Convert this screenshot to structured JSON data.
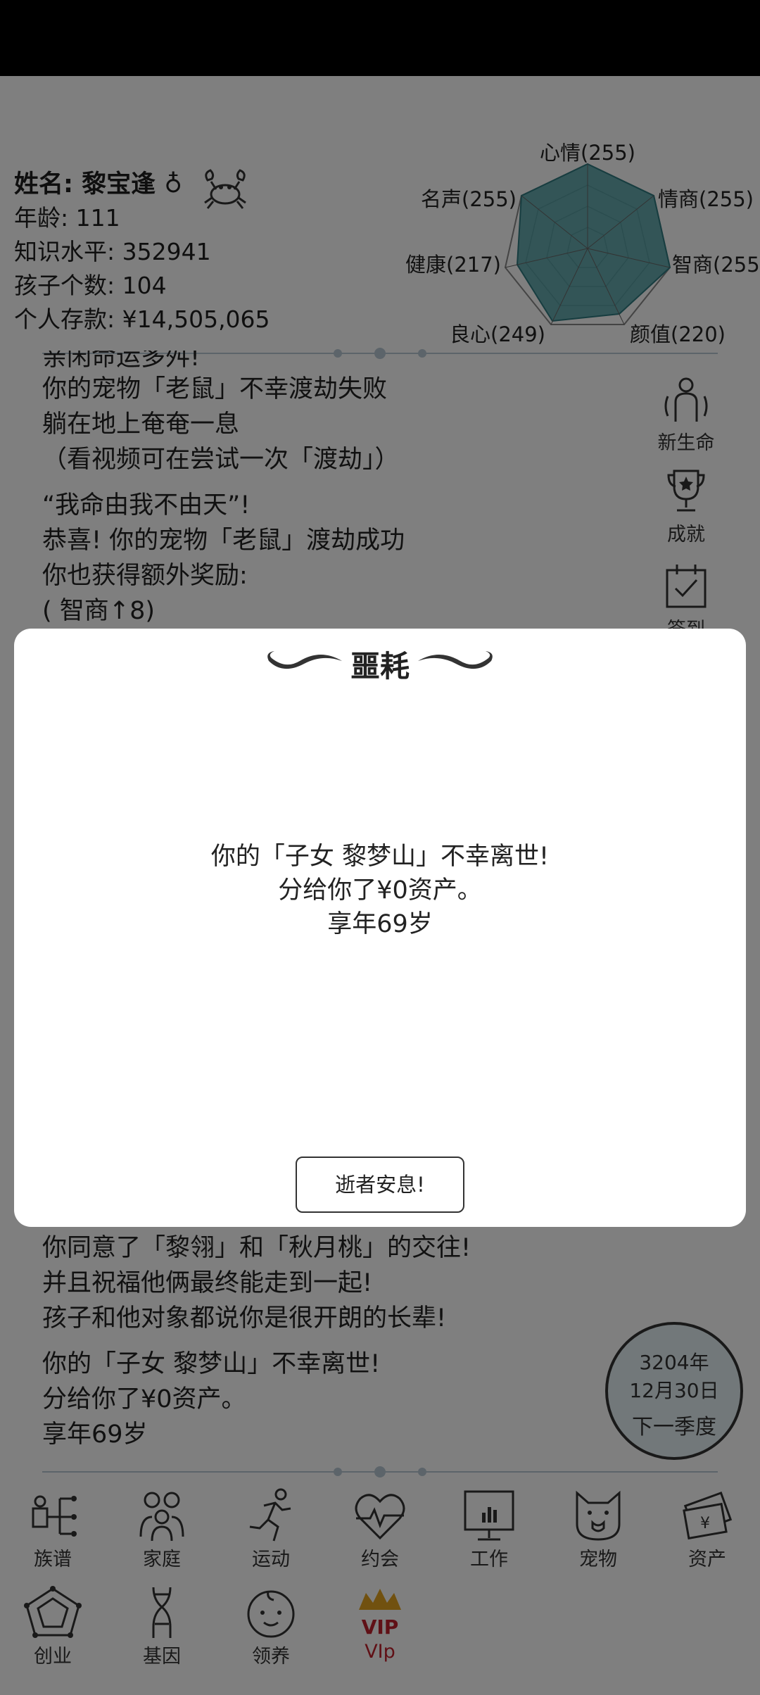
{
  "profile": {
    "name": "姓名: 黎宝逢 ♁",
    "age": "年龄: 111",
    "knowledge": "知识水平: 352941",
    "children": "孩子个数: 104",
    "savings": "个人存款: ¥14,505,065"
  },
  "stats": {
    "mood": "心情(255)",
    "eq": "情商(255)",
    "iq": "智商(255)",
    "looks": "颜值(220)",
    "conscience": "良心(249)",
    "health": "健康(217)",
    "fame": "名声(255)"
  },
  "story_top": [
    "亲闲命运多舛!",
    "你的宠物「老鼠」不幸渡劫失败",
    "躺在地上奄奄一息",
    "（看视频可在尝试一次「渡劫」）",
    "“我命由我不由天”!",
    "恭喜! 你的宠物「老鼠」渡劫成功",
    " 你也获得额外奖励:",
    "(   智商↑8)"
  ],
  "story_bottom": [
    "你同意了「黎翎」和「秋月桃」的交往!",
    "并且祝福他俩最终能走到一起!",
    "孩子和他对象都说你是很开朗的长辈!",
    "你的「子女 黎梦山」不幸离世!",
    "分给你了¥0资产。",
    "享年69岁"
  ],
  "side_menu": {
    "new_life": "新生命",
    "achievement": "成就",
    "checkin": "签到"
  },
  "date": {
    "year": "3204年",
    "day": "12月30日",
    "next": "下一季度"
  },
  "nav": {
    "clan": "族谱",
    "family": "家庭",
    "sport": "运动",
    "date": "约会",
    "work": "工作",
    "pet": "宠物",
    "assets": "资产",
    "startup": "创业",
    "gene": "基因",
    "adopt": "领养",
    "vip": "VIp",
    "vip_badge": "VIP"
  },
  "modal": {
    "title": "噩耗",
    "line1": "你的「子女 黎梦山」不幸离世!",
    "line2": "分给你了¥0资产。",
    "line3": "享年69岁",
    "button": "逝者安息!"
  },
  "colors": {
    "radar_fill": "#4b9ba0",
    "vip": "#c0202c",
    "date_bg": "#e4f1f4"
  }
}
